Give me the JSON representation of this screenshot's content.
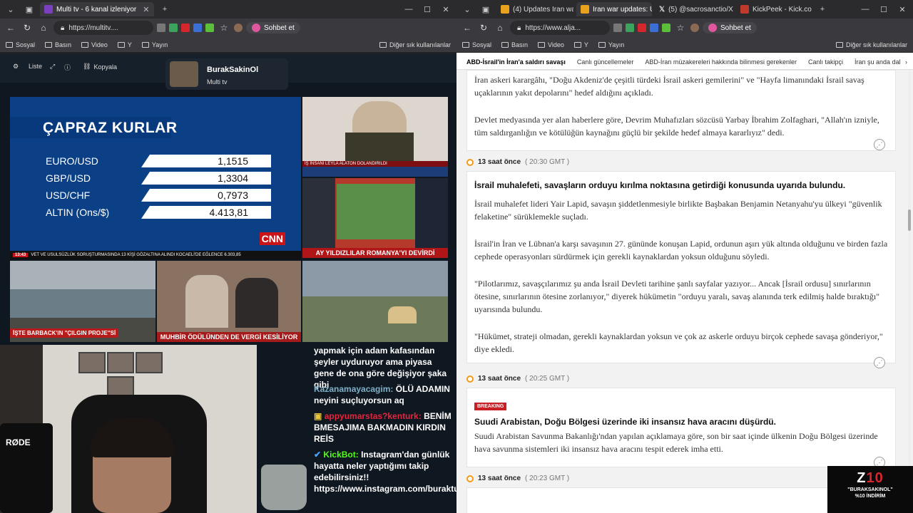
{
  "left": {
    "tabs": [
      {
        "label": "Multi tv - 6 kanal izleniyor",
        "active": true
      }
    ],
    "address": "https://multitv....",
    "copilot_label": "Sohbet et",
    "bookmarks": [
      "Sosyal",
      "Basın",
      "Video",
      "Y",
      "Yayın"
    ],
    "bookmarks_right": "Diğer sık kullanılanlar",
    "toolbar": {
      "list_label": "Liste",
      "copy_label": "Kopyala"
    },
    "profile": {
      "name": "BurakSakinOl",
      "sub": "Multi tv"
    },
    "crossrates": {
      "title": "ÇAPRAZ KURLAR",
      "rows": [
        {
          "label": "EURO/USD",
          "value": "1,1515"
        },
        {
          "label": "GBP/USD",
          "value": "1,3304"
        },
        {
          "label": "USD/CHF",
          "value": "0,7973"
        },
        {
          "label": "ALTIN (Ons/$)",
          "value": "4.413,81"
        }
      ],
      "brand": "CNN",
      "ticker_time": "13:43",
      "ticker": "VET VE USULSÜZLÜK SORUŞTURMASINDA 13 KİŞİ GÖZALTINA ALINDI   KOCAELİ'DE EĞLENCE   6.303,85"
    },
    "tile_captions": {
      "woman": "İŞ İNSANI LEYLA ALATON DOLANDIRILDI",
      "sport": "AY YILDIZLILAR ROMANYA'YI DEVİRDİ",
      "sea": "İŞTE BARBACK'IN \"ÇILGIN PROJE\"Sİ",
      "news": "MUHBİR ÖDÜLÜNDEN DE VERGİ KESİLİYOR"
    },
    "webcam": {
      "mic_label": "RØDE"
    },
    "chat": [
      {
        "user": "",
        "text": "yapmak için adam kafasından şeyler uyduruyor ama piyasa gene de ona göre değişiyor şaka gibi"
      },
      {
        "user": "Kazanamayacagim:",
        "text": "ÖLÜ ADAMIN neyini suçluyorsun aq"
      },
      {
        "user": "appyumarstas?kenturk:",
        "text": "BENİM BMESAJIMA BAKMADIN KIRDIN REİS"
      },
      {
        "user": "KickBot:",
        "text": "Instagram'dan günlük hayatta neler yaptığımı takip edebilirsiniz!! https://www.instagram.com/buraktut/"
      }
    ]
  },
  "right": {
    "tabs": [
      {
        "label": "(4) Updates Iran war",
        "active": false
      },
      {
        "label": "Iran war updates: US",
        "active": true
      },
      {
        "label": "(5) @sacrosanctio/X",
        "active": false
      },
      {
        "label": "KickPeek - Kick.com",
        "active": false
      }
    ],
    "address": "https://www.alja...",
    "copilot_label": "Sohbet et",
    "bookmarks": [
      "Sosyal",
      "Basın",
      "Video",
      "Y",
      "Yayın"
    ],
    "bookmarks_right": "Diğer sık kullanılanlar",
    "subnav": [
      "ABD-İsrail'in İran'a saldırı savaşı",
      "Canlı güncellemeler",
      "ABD-İran müzakereleri hakkında bilinmesi gerekenler",
      "Canlı takipçi",
      "İran şu anda dal"
    ],
    "entry0": {
      "p1": "İran askeri karargâhı, \"Doğu Akdeniz'de çeşitli türdeki İsrail askeri gemilerini\" ve \"Hayfa limanındaki İsrail savaş uçaklarının yakıt depolarını\" hedef aldığını açıkladı.",
      "p2": "Devlet medyasında yer alan haberlere göre, Devrim Muhafızları sözcüsü Yarbay İbrahim Zolfaghari, \"Allah'ın izniyle, tüm saldırganlığın ve kötülüğün kaynağını güçlü bir şekilde hedef almaya kararlıyız\" dedi."
    },
    "entry1": {
      "time": "13 saat önce",
      "gmt": "( 20:30 GMT )",
      "headline": "İsrail muhalefeti, savaşların orduyu kırılma noktasına getirdiği konusunda uyarıda bulundu.",
      "p1": "İsrail muhalefet lideri Yair Lapid, savaşın şiddetlenmesiyle birlikte Başbakan Benjamin Netanyahu'yu ülkeyi \"güvenlik felaketine\" sürüklemekle suçladı.",
      "p2": "İsrail'in İran ve Lübnan'a karşı savaşının 27. gününde konuşan Lapid, ordunun aşırı yük altında olduğunu ve birden fazla cephede operasyonları sürdürmek için gerekli kaynaklardan yoksun olduğunu söyledi.",
      "p3": "\"Pilotlarımız, savaşçılarımız şu anda İsrail Devleti tarihine şanlı sayfalar yazıyor... Ancak [İsrail ordusu] sınırlarının ötesine, sınırlarının ötesine zorlanıyor,\" diyerek hükümetin \"orduyu yaralı, savaş alanında terk edilmiş halde bıraktığı\" uyarısında bulundu.",
      "p4": "\"Hükümet, strateji olmadan, gerekli kaynaklardan yoksun ve çok az askerle orduyu birçok cephede savaşa gönderiyor,\" diye ekledi."
    },
    "entry2": {
      "time": "13 saat önce",
      "gmt": "( 20:25 GMT )",
      "badge": "BREAKING",
      "headline": "Suudi Arabistan, Doğu Bölgesi üzerinde iki insansız hava aracını düşürdü.",
      "p1": "Suudi Arabistan Savunma Bakanlığı'ndan yapılan açıklamaya göre, son bir saat içinde ülkenin Doğu Bölgesi üzerinde hava savunma sistemleri iki insansız hava aracını tespit ederek imha etti."
    },
    "entry3": {
      "time": "13 saat önce",
      "gmt": "( 20:23 GMT )"
    },
    "promo": {
      "logo_a": "Z",
      "logo_b": "10",
      "line1": "\"BURAKSAKINOL\"",
      "line2": "%10 İNDİRİM"
    }
  },
  "colors": {
    "accent_red": "#c81e26",
    "timeline_orange": "#f39c12",
    "cnn_blue": "#0b3f86"
  }
}
